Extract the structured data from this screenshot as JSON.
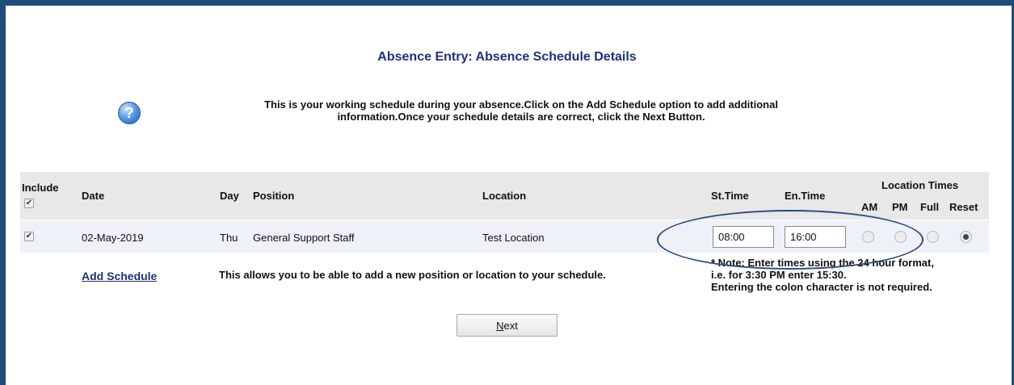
{
  "page": {
    "title": "Absence Entry: Absence Schedule Details",
    "instructions_line1": "This is your working schedule during your absence.Click on the Add Schedule option to add additional",
    "instructions_line2": "information.Once your schedule details are correct, click the Next Button.",
    "help_icon_glyph": "?"
  },
  "table": {
    "headers": {
      "include": "Include",
      "date": "Date",
      "day": "Day",
      "position": "Position",
      "location": "Location",
      "st_time": "St.Time",
      "en_time": "En.Time",
      "location_times": "Location Times",
      "am": "AM",
      "pm": "PM",
      "full": "Full",
      "reset": "Reset"
    },
    "header_include_checked": "✔",
    "rows": [
      {
        "include": "✔",
        "date": "02-May-2019",
        "day": "Thu",
        "position": "General Support Staff",
        "location": "Test Location",
        "st_time": "08:00",
        "en_time": "16:00",
        "location_time_selected": "Reset"
      }
    ]
  },
  "actions": {
    "add_schedule_label": "Add Schedule",
    "add_schedule_desc": "This allows you to be able to add a new position or location to your schedule.",
    "next_label_underlined": "N",
    "next_label_rest": "ext"
  },
  "note": {
    "line1": "* Note: Enter times using the 24 hour format,",
    "line2": "i.e. for 3:30 PM enter 15:30.",
    "line3": "Entering the colon character is not required."
  },
  "colors": {
    "frame": "#1f4e79",
    "title": "#1e3278",
    "header_band": "#e8e8e8",
    "row_band": "#eef1f8",
    "annotation": "#2a4a80"
  }
}
